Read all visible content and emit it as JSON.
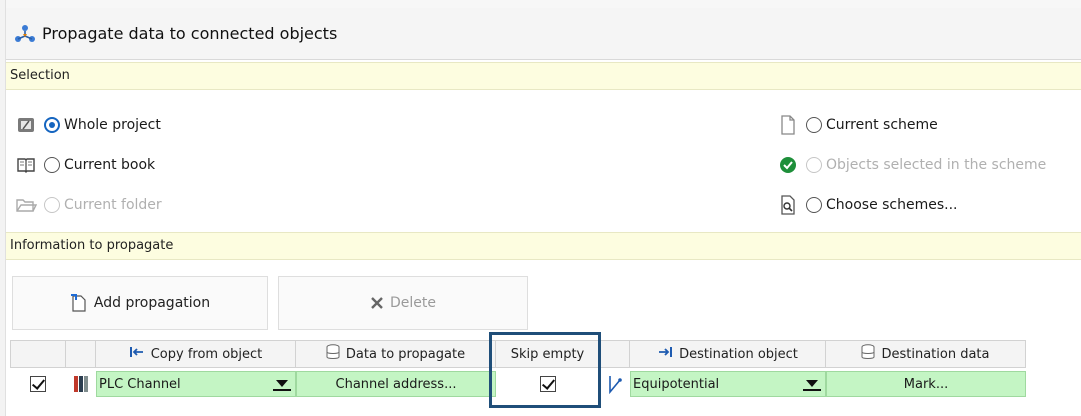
{
  "window": {
    "title": "Propagate data to connected objects"
  },
  "selection": {
    "header": "Selection",
    "options": {
      "whole_project": {
        "label": "Whole project",
        "checked": true
      },
      "current_book": {
        "label": "Current book",
        "checked": false
      },
      "current_folder": {
        "label": "Current folder",
        "checked": false,
        "disabled": true
      },
      "current_scheme": {
        "label": "Current scheme",
        "checked": false
      },
      "objects_selected": {
        "label": "Objects selected in the scheme",
        "checked": false,
        "disabled": true
      },
      "choose_schemes": {
        "label": "Choose schemes...",
        "checked": false
      }
    }
  },
  "information": {
    "header": "Information to propagate",
    "add_label": "Add propagation",
    "delete_label": "Delete"
  },
  "grid": {
    "columns": {
      "copy_from": "Copy from object",
      "data_to_propagate": "Data to propagate",
      "skip_empty": "Skip empty",
      "destination_object": "Destination object",
      "destination_data": "Destination data"
    },
    "rows": [
      {
        "enabled": true,
        "copy_from": "PLC Channel",
        "data_to_propagate": "Channel address...",
        "skip_empty": true,
        "destination_object": "Equipotential",
        "destination_data": "Mark..."
      }
    ]
  },
  "colors": {
    "accent": "#1565c0",
    "highlight_border": "#1f4e79",
    "row_fill": "#c4f5c4",
    "section_fill": "#fdfde0"
  }
}
